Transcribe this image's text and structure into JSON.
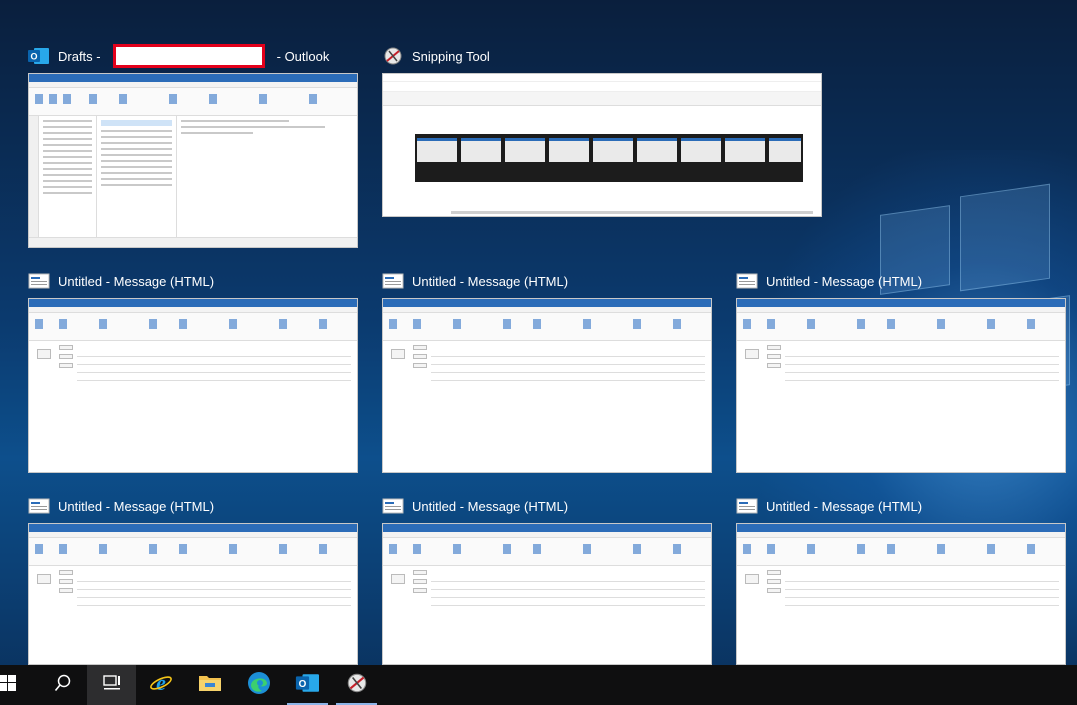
{
  "windows": [
    {
      "app": "outlook",
      "title_prefix": "Drafts -",
      "title_suffix": "- Outlook",
      "redacted": true,
      "icon": "outlook-icon"
    },
    {
      "app": "snipping",
      "title": "Snipping Tool",
      "icon": "snipping-tool-icon"
    },
    {
      "app": "message",
      "title": "Untitled - Message (HTML)",
      "icon": "compose-message-icon"
    },
    {
      "app": "message",
      "title": "Untitled - Message (HTML)",
      "icon": "compose-message-icon"
    },
    {
      "app": "message",
      "title": "Untitled - Message (HTML)",
      "icon": "compose-message-icon"
    },
    {
      "app": "message",
      "title": "Untitled - Message (HTML)",
      "icon": "compose-message-icon"
    },
    {
      "app": "message",
      "title": "Untitled - Message (HTML)",
      "icon": "compose-message-icon"
    },
    {
      "app": "message",
      "title": "Untitled - Message (HTML)",
      "icon": "compose-message-icon"
    }
  ],
  "taskbar": {
    "items": [
      {
        "name": "start",
        "icon": "windows-logo-icon"
      },
      {
        "name": "search",
        "icon": "search-icon"
      },
      {
        "name": "task-view",
        "icon": "task-view-icon",
        "active": true
      },
      {
        "name": "internet-explorer",
        "icon": "internet-explorer-icon"
      },
      {
        "name": "file-explorer",
        "icon": "folder-icon"
      },
      {
        "name": "edge",
        "icon": "edge-icon"
      },
      {
        "name": "outlook",
        "icon": "outlook-icon",
        "running": true
      },
      {
        "name": "snipping-tool",
        "icon": "snipping-tool-icon",
        "running": true
      }
    ]
  },
  "colors": {
    "accent": "#2b6cb8",
    "redaction_border": "#e3001b",
    "taskbar": "#0f0f10"
  }
}
